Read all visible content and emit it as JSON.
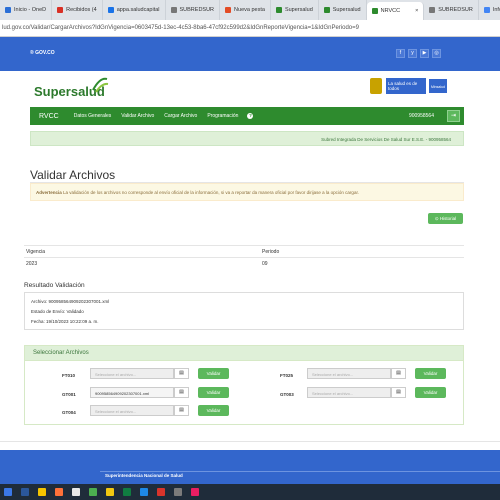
{
  "browser": {
    "tabs": [
      {
        "label": "Inicio - OneD",
        "color": "#2b6fd6"
      },
      {
        "label": "Recibidos (4",
        "color": "#d93025"
      },
      {
        "label": "appa.saludcapital",
        "color": "#1a73e8"
      },
      {
        "label": "SUBREDSUR",
        "color": "#777777"
      },
      {
        "label": "Nueva pesta",
        "color": "#e34c26"
      },
      {
        "label": "Supersalud",
        "color": "#2e8b2e"
      },
      {
        "label": "Supersalud",
        "color": "#2e8b2e"
      },
      {
        "label": "NRVCC",
        "color": "#2e8b2e",
        "active": true
      },
      {
        "label": "SUBREDSUR",
        "color": "#777777"
      },
      {
        "label": "Inform",
        "color": "#4285f4"
      }
    ],
    "close_icon": "×",
    "url": "lud.gov.co/Validar/CargarArchivos?IdGnVigencia=0603475d-13ec-4c53-8ba6-47cf92c599d2&IdGnReporteVigencia=1&IdGnPeriodo=9"
  },
  "gov_bar": {
    "logo": "® GOV.CO",
    "social": [
      "f",
      "y",
      "▶",
      "◎"
    ]
  },
  "header": {
    "brand": "Supersalud",
    "gov_badge": "La salud es de todos",
    "ministry_badge": "Minsalud"
  },
  "nav": {
    "home": "RVCC",
    "items": [
      "Datos Generales",
      "Validar Archivo",
      "Cargar Archivo",
      "Programación"
    ],
    "help_icon": "?",
    "nit": "900958564",
    "exit_icon": "⇥"
  },
  "entity_banner": "Subred Integrada De Servicios De Salud Sur E.S.E. - 900958564",
  "page_title": "Validar Archivos",
  "warning": {
    "label": "Advertencia",
    "text": "La validación de los archivos no corresponde al envío oficial de la información, si va a reportar da manera oficial por favor dirijase a la opción cargar."
  },
  "history_button": "⊙ Historial",
  "period_table": {
    "headers": [
      "Vigencia",
      "Periodo"
    ],
    "row": [
      "2023",
      "09"
    ]
  },
  "result": {
    "title": "Resultado Validación",
    "lines": [
      "Archivo: 900958564909202307001.xml",
      "Estado de Envío: Validado",
      "Fecha: 19/10/2023 10:22:09 a. m."
    ]
  },
  "select_files": {
    "title": "Seleccionar Archivos",
    "placeholder": "Seleccione el archivo...",
    "validate_label": "Validar",
    "files": [
      {
        "code": "FT010",
        "value": ""
      },
      {
        "code": "FT025",
        "value": ""
      },
      {
        "code": "GT001",
        "value": "900958564909202307001.xml"
      },
      {
        "code": "GT003",
        "value": ""
      },
      {
        "code": "GT004",
        "value": ""
      }
    ]
  },
  "footer": {
    "title": "Superintendencia Nacional de Salud"
  },
  "taskbar_icons": [
    "#3b78e7",
    "#2b579a",
    "#f5c400",
    "#ff7139",
    "#e8e8e8",
    "#4caf50",
    "#f2c811",
    "#107c41",
    "#1e88e5",
    "#d9342b",
    "#7b7b7b",
    "#e91e63"
  ]
}
